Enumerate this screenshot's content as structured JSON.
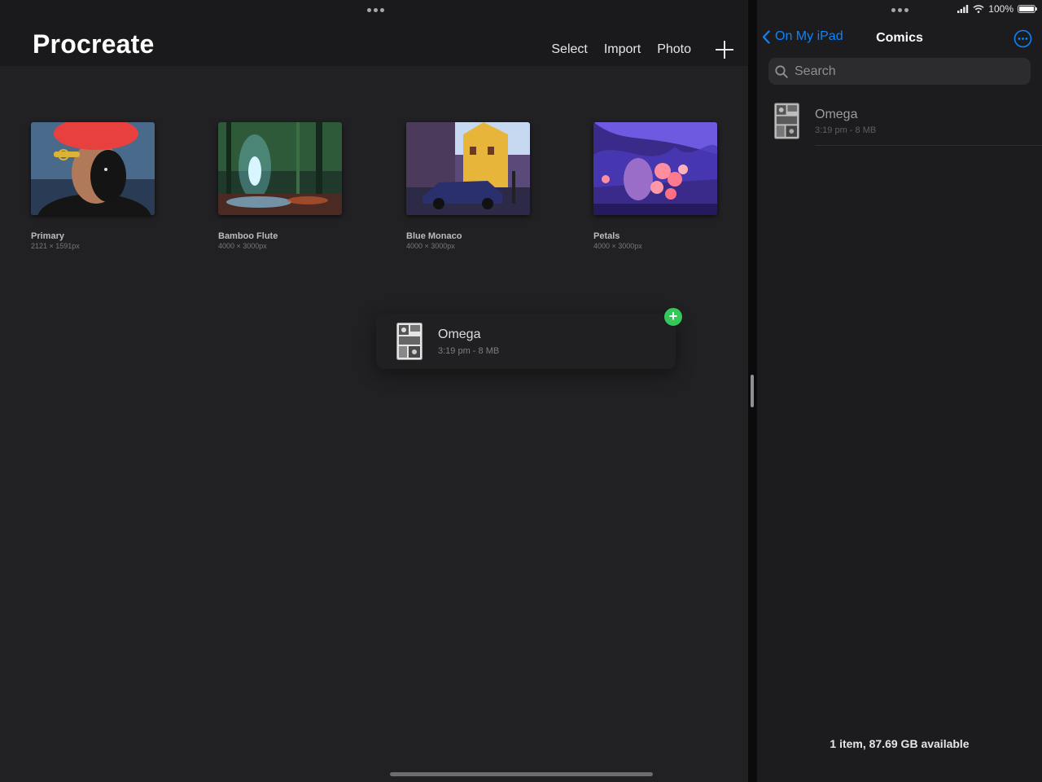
{
  "procreate": {
    "title": "Procreate",
    "toolbar": {
      "select_label": "Select",
      "import_label": "Import",
      "photo_label": "Photo",
      "new_icon": "plus-icon"
    },
    "artworks": [
      {
        "name": "Primary",
        "dims": "2121 × 1591px"
      },
      {
        "name": "Bamboo Flute",
        "dims": "4000 × 3000px"
      },
      {
        "name": "Blue Monaco",
        "dims": "4000 × 3000px"
      },
      {
        "name": "Petals",
        "dims": "4000 × 3000px"
      }
    ],
    "drag_item": {
      "name": "Omega",
      "meta": "3:19 pm - 8 MB",
      "badge": "+"
    }
  },
  "files": {
    "status": {
      "battery_percent": "100%"
    },
    "nav": {
      "back_label": "On My iPad",
      "title": "Comics"
    },
    "search": {
      "placeholder": "Search"
    },
    "items": [
      {
        "name": "Omega",
        "meta": "3:19 pm - 8 MB"
      }
    ],
    "footer": "1 item, 87.69 GB available"
  },
  "colors": {
    "accent_blue": "#0a84ff",
    "add_badge_green": "#34c759",
    "left_background": "#212123",
    "right_background": "#1c1c1e"
  }
}
